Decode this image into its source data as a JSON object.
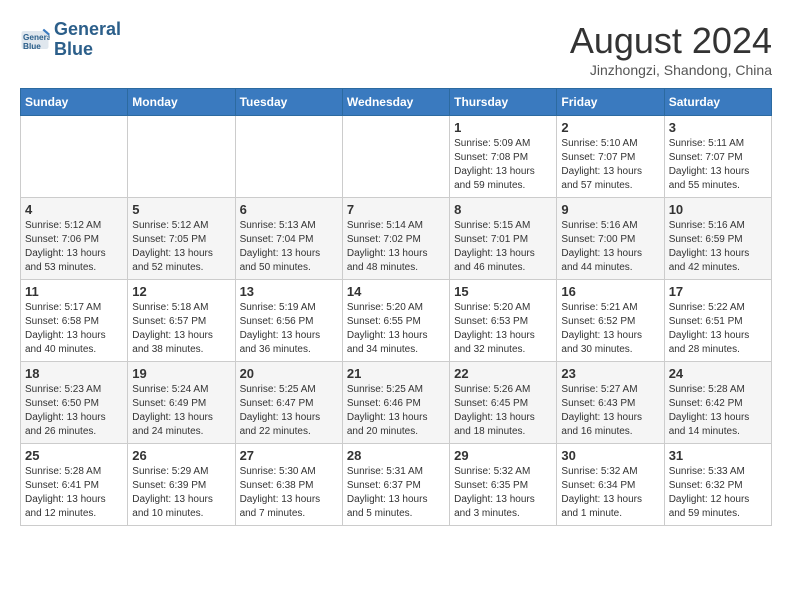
{
  "header": {
    "logo_line1": "General",
    "logo_line2": "Blue",
    "month_title": "August 2024",
    "subtitle": "Jinzhongzi, Shandong, China"
  },
  "days_of_week": [
    "Sunday",
    "Monday",
    "Tuesday",
    "Wednesday",
    "Thursday",
    "Friday",
    "Saturday"
  ],
  "weeks": [
    [
      {
        "day": "",
        "info": ""
      },
      {
        "day": "",
        "info": ""
      },
      {
        "day": "",
        "info": ""
      },
      {
        "day": "",
        "info": ""
      },
      {
        "day": "1",
        "info": "Sunrise: 5:09 AM\nSunset: 7:08 PM\nDaylight: 13 hours and 59 minutes."
      },
      {
        "day": "2",
        "info": "Sunrise: 5:10 AM\nSunset: 7:07 PM\nDaylight: 13 hours and 57 minutes."
      },
      {
        "day": "3",
        "info": "Sunrise: 5:11 AM\nSunset: 7:07 PM\nDaylight: 13 hours and 55 minutes."
      }
    ],
    [
      {
        "day": "4",
        "info": "Sunrise: 5:12 AM\nSunset: 7:06 PM\nDaylight: 13 hours and 53 minutes."
      },
      {
        "day": "5",
        "info": "Sunrise: 5:12 AM\nSunset: 7:05 PM\nDaylight: 13 hours and 52 minutes."
      },
      {
        "day": "6",
        "info": "Sunrise: 5:13 AM\nSunset: 7:04 PM\nDaylight: 13 hours and 50 minutes."
      },
      {
        "day": "7",
        "info": "Sunrise: 5:14 AM\nSunset: 7:02 PM\nDaylight: 13 hours and 48 minutes."
      },
      {
        "day": "8",
        "info": "Sunrise: 5:15 AM\nSunset: 7:01 PM\nDaylight: 13 hours and 46 minutes."
      },
      {
        "day": "9",
        "info": "Sunrise: 5:16 AM\nSunset: 7:00 PM\nDaylight: 13 hours and 44 minutes."
      },
      {
        "day": "10",
        "info": "Sunrise: 5:16 AM\nSunset: 6:59 PM\nDaylight: 13 hours and 42 minutes."
      }
    ],
    [
      {
        "day": "11",
        "info": "Sunrise: 5:17 AM\nSunset: 6:58 PM\nDaylight: 13 hours and 40 minutes."
      },
      {
        "day": "12",
        "info": "Sunrise: 5:18 AM\nSunset: 6:57 PM\nDaylight: 13 hours and 38 minutes."
      },
      {
        "day": "13",
        "info": "Sunrise: 5:19 AM\nSunset: 6:56 PM\nDaylight: 13 hours and 36 minutes."
      },
      {
        "day": "14",
        "info": "Sunrise: 5:20 AM\nSunset: 6:55 PM\nDaylight: 13 hours and 34 minutes."
      },
      {
        "day": "15",
        "info": "Sunrise: 5:20 AM\nSunset: 6:53 PM\nDaylight: 13 hours and 32 minutes."
      },
      {
        "day": "16",
        "info": "Sunrise: 5:21 AM\nSunset: 6:52 PM\nDaylight: 13 hours and 30 minutes."
      },
      {
        "day": "17",
        "info": "Sunrise: 5:22 AM\nSunset: 6:51 PM\nDaylight: 13 hours and 28 minutes."
      }
    ],
    [
      {
        "day": "18",
        "info": "Sunrise: 5:23 AM\nSunset: 6:50 PM\nDaylight: 13 hours and 26 minutes."
      },
      {
        "day": "19",
        "info": "Sunrise: 5:24 AM\nSunset: 6:49 PM\nDaylight: 13 hours and 24 minutes."
      },
      {
        "day": "20",
        "info": "Sunrise: 5:25 AM\nSunset: 6:47 PM\nDaylight: 13 hours and 22 minutes."
      },
      {
        "day": "21",
        "info": "Sunrise: 5:25 AM\nSunset: 6:46 PM\nDaylight: 13 hours and 20 minutes."
      },
      {
        "day": "22",
        "info": "Sunrise: 5:26 AM\nSunset: 6:45 PM\nDaylight: 13 hours and 18 minutes."
      },
      {
        "day": "23",
        "info": "Sunrise: 5:27 AM\nSunset: 6:43 PM\nDaylight: 13 hours and 16 minutes."
      },
      {
        "day": "24",
        "info": "Sunrise: 5:28 AM\nSunset: 6:42 PM\nDaylight: 13 hours and 14 minutes."
      }
    ],
    [
      {
        "day": "25",
        "info": "Sunrise: 5:28 AM\nSunset: 6:41 PM\nDaylight: 13 hours and 12 minutes."
      },
      {
        "day": "26",
        "info": "Sunrise: 5:29 AM\nSunset: 6:39 PM\nDaylight: 13 hours and 10 minutes."
      },
      {
        "day": "27",
        "info": "Sunrise: 5:30 AM\nSunset: 6:38 PM\nDaylight: 13 hours and 7 minutes."
      },
      {
        "day": "28",
        "info": "Sunrise: 5:31 AM\nSunset: 6:37 PM\nDaylight: 13 hours and 5 minutes."
      },
      {
        "day": "29",
        "info": "Sunrise: 5:32 AM\nSunset: 6:35 PM\nDaylight: 13 hours and 3 minutes."
      },
      {
        "day": "30",
        "info": "Sunrise: 5:32 AM\nSunset: 6:34 PM\nDaylight: 13 hours and 1 minute."
      },
      {
        "day": "31",
        "info": "Sunrise: 5:33 AM\nSunset: 6:32 PM\nDaylight: 12 hours and 59 minutes."
      }
    ]
  ]
}
